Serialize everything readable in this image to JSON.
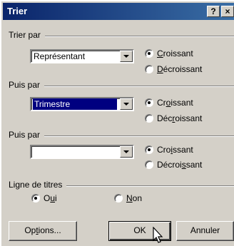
{
  "window": {
    "title": "Trier",
    "help_label": "?",
    "close_label": "×"
  },
  "sort1": {
    "legend": "Trier par",
    "field": "Représentant",
    "asc_pre": "",
    "asc_ul": "C",
    "asc_post": "roissant",
    "desc_pre": "",
    "desc_ul": "D",
    "desc_post": "écroissant",
    "selected": "asc"
  },
  "sort2": {
    "legend": "Puis par",
    "field": "Trimestre",
    "asc_pre": "Cr",
    "asc_ul": "o",
    "asc_post": "issant",
    "desc_pre": "Déc",
    "desc_ul": "r",
    "desc_post": "oissant",
    "selected": "asc"
  },
  "sort3": {
    "legend": "Puis par",
    "field": "",
    "asc_pre": "Cro",
    "asc_ul": "i",
    "asc_post": "ssant",
    "desc_pre": "Décroi",
    "desc_ul": "s",
    "desc_post": "sant",
    "selected": "asc"
  },
  "header_row": {
    "legend": "Ligne de titres",
    "yes_pre": "O",
    "yes_ul": "u",
    "yes_post": "i",
    "no_pre": "",
    "no_ul": "N",
    "no_post": "on",
    "selected": "yes"
  },
  "buttons": {
    "options_pre": "Op",
    "options_ul": "t",
    "options_post": "ions...",
    "ok": "OK",
    "cancel": "Annuler"
  }
}
